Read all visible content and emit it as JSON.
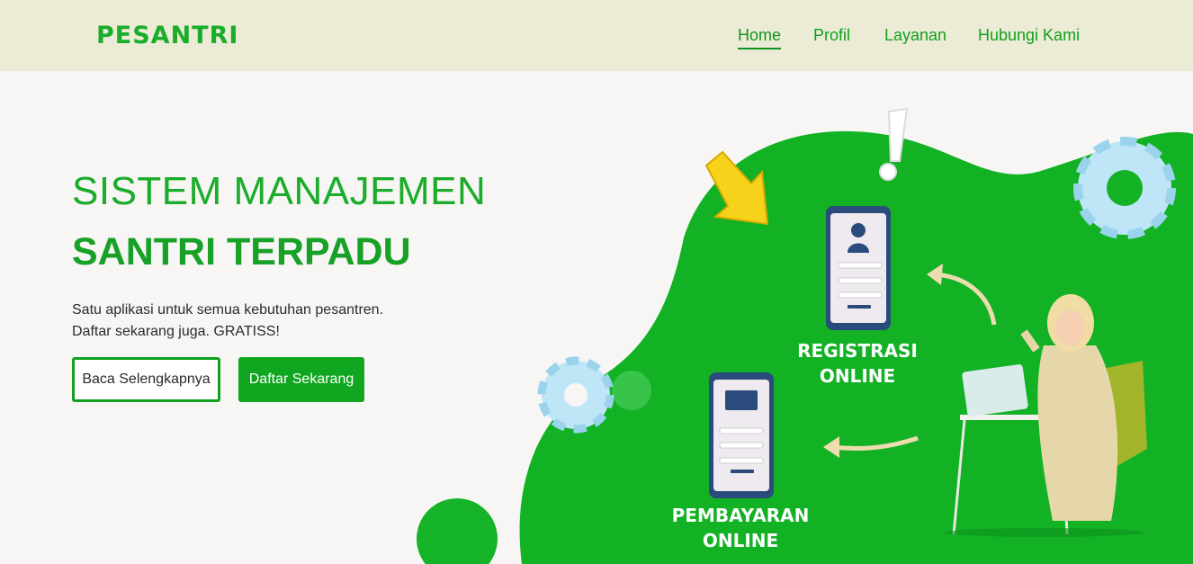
{
  "brand": {
    "logo": "PESANTRI"
  },
  "nav": {
    "items": [
      {
        "label": "Home",
        "active": true
      },
      {
        "label": "Profil",
        "active": false
      },
      {
        "label": "Layanan",
        "active": false
      },
      {
        "label": "Hubungi Kami",
        "active": false
      }
    ]
  },
  "hero": {
    "title_line1": "SISTEM MANAJEMEN",
    "title_line2": "SANTRI TERPADU",
    "desc_line1": "Satu aplikasi untuk semua kebutuhan pesantren.",
    "desc_line2": "Daftar sekarang juga. GRATISS!",
    "btn_more": "Baca Selengkapnya",
    "btn_register": "Daftar Sekarang"
  },
  "illustration": {
    "label_registrasi_1": "REGISTRASI",
    "label_registrasi_2": "ONLINE",
    "label_pembayaran_1": "PEMBAYARAN",
    "label_pembayaran_2": "ONLINE"
  },
  "colors": {
    "accent": "#11a01f",
    "navbar_bg": "#ecebd6",
    "page_bg": "#f7f6f4",
    "blob": "#12b224"
  }
}
